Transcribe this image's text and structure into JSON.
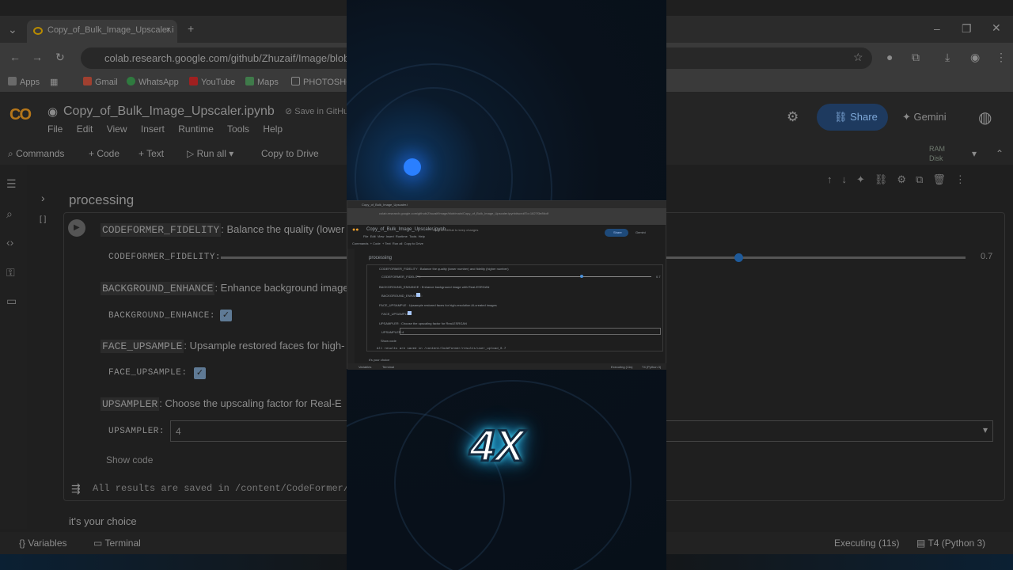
{
  "browser": {
    "tab_title": "Copy_of_Bulk_Image_Upscaler.i",
    "url": "colab.research.google.com/github/Zhuzaif/Image/blob/main",
    "bookmarks": [
      "Apps",
      "Gmail",
      "WhatsApp",
      "YouTube",
      "Maps",
      "PHOTOSHO"
    ]
  },
  "colab": {
    "logo": "CO",
    "notebook_title": "Copy_of_Bulk_Image_Upscaler.ipynb",
    "save_github": "Save in GitHub to",
    "menu": [
      "File",
      "Edit",
      "View",
      "Insert",
      "Runtime",
      "Tools",
      "Help"
    ],
    "share_label": "Share",
    "gemini_label": "Gemini",
    "toolbar": [
      "Commands",
      "Code",
      "Text",
      "Run all",
      "Copy to Drive"
    ],
    "ram_label": "RAM",
    "disk_label": "Disk"
  },
  "cell": {
    "section_title": "processing",
    "exec_marker": "[ ]",
    "fidelity": {
      "code": "CODEFORMER_FIDELITY",
      "desc": ": Balance the quality (lower",
      "label": "CODEFORMER_FIDELITY:",
      "value": "0.7",
      "fraction": 0.7
    },
    "bg_enhance": {
      "code": "BACKGROUND_ENHANCE",
      "desc": ": Enhance background image",
      "label": "BACKGROUND_ENHANCE:",
      "checked": true
    },
    "face_upsample": {
      "code": "FACE_UPSAMPLE",
      "desc": ": Upsample restored faces for high-",
      "label": "FACE_UPSAMPLE:",
      "checked": true
    },
    "upsampler": {
      "code": "UPSAMPLER",
      "desc": ": Choose the upscaling factor for Real-E",
      "label": "UPSAMPLER:",
      "value": "4"
    },
    "show_code": "Show code",
    "output": "All results are saved in /content/CodeFormer/resul",
    "text_below": "it's your choice"
  },
  "status": {
    "variables": "Variables",
    "terminal": "Terminal",
    "executing": "Executing (11s)",
    "runtime": "T4 (Python 3)"
  },
  "mini": {
    "tab_title": "Copy_of_Bulk_Image_Upscaler.i",
    "url": "colab.research.google.com/github/Zhuzaif/Image/blob/main/Copy_of_Bulk_Image_Upscaler.ipynb#scrollTo=1827f3e8fcdf",
    "notebook_title": "Copy_of_Bulk_Image_Upscaler.ipynb",
    "save_github": "Save in GitHub to keep changes",
    "menu": [
      "File",
      "Edit",
      "View",
      "Insert",
      "Runtime",
      "Tools",
      "Help"
    ],
    "share_label": "Share",
    "gemini_label": "Gemini",
    "toolbar": [
      "Commands",
      "+ Code",
      "+ Text",
      "Run all",
      "Copy to Drive"
    ],
    "section_title": "processing",
    "fidelity_line": "CODEFORMER_FIDELITY : Balance the quality (lower number) and fidelity (higher number)",
    "fidelity_label": "CODEFORMER_FIDELITY:",
    "fidelity_value": "0.7",
    "bg_line": "BACKGROUND_ENHANCE : Enhance background image with Real-ESRGAN",
    "bg_label": "BACKGROUND_ENHANCE:",
    "face_line": "FACE_UPSAMPLE : Upsample restored faces for high-resolution AI-created images",
    "face_label": "FACE_UPSAMPLE:",
    "upsampler_line": "UPSAMPLER : Choose the upscaling factor for Real-ESRGAN",
    "upsampler_label": "UPSAMPLER:",
    "upsampler_value": "4",
    "show_code": "Show code",
    "output": "All results are saved in /content/CodeFormer/results/user_upload_0.7",
    "text_below": "it's your choice",
    "variables": "Variables",
    "terminal": "Terminal",
    "executing": "Executing (11s)",
    "runtime": "T4 (Python 3)"
  },
  "overlay": {
    "label": "4X",
    "glow_color": "#2cc8ff"
  }
}
